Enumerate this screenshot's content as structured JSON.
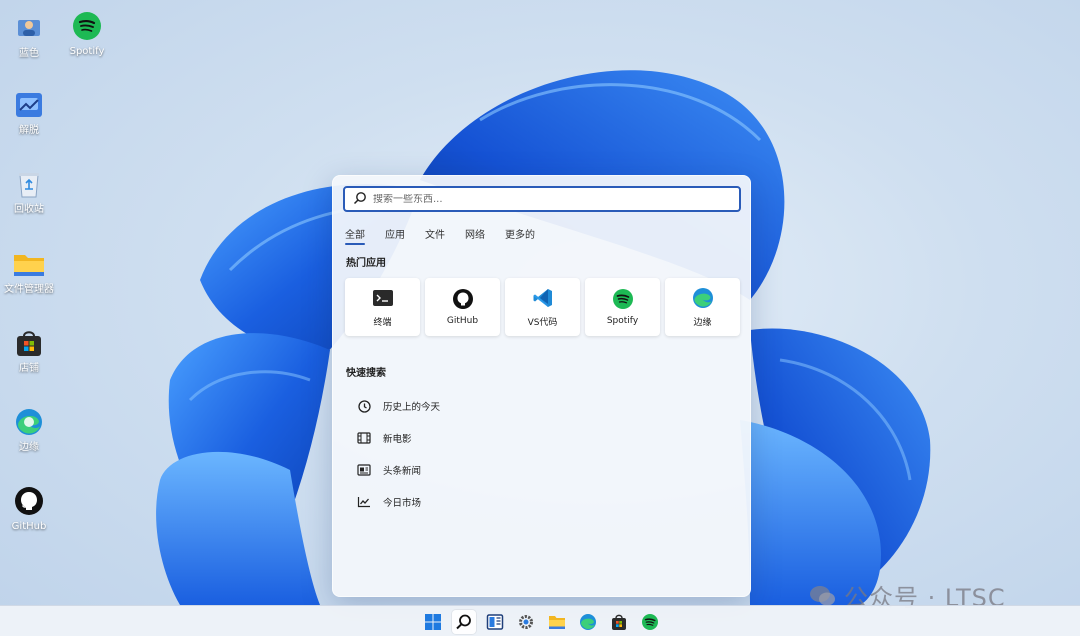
{
  "desktop": {
    "icons": [
      {
        "label": "蓝色",
        "icon": "user-folder-icon"
      },
      {
        "label": "Spotify",
        "icon": "spotify-icon"
      },
      {
        "label": "解脱",
        "icon": "control-panel-icon"
      },
      {
        "label": "回收站",
        "icon": "recycle-bin-icon"
      },
      {
        "label": "文件管理器",
        "icon": "folder-icon"
      },
      {
        "label": "店铺",
        "icon": "store-icon"
      },
      {
        "label": "边缘",
        "icon": "edge-icon"
      },
      {
        "label": "GitHub",
        "icon": "github-icon"
      }
    ]
  },
  "search": {
    "placeholder": "搜索一些东西...",
    "tabs": [
      {
        "label": "全部",
        "active": true
      },
      {
        "label": "应用",
        "active": false
      },
      {
        "label": "文件",
        "active": false
      },
      {
        "label": "网络",
        "active": false
      },
      {
        "label": "更多的",
        "active": false
      }
    ],
    "popular_title": "热门应用",
    "apps": [
      {
        "label": "终端",
        "icon": "terminal-icon"
      },
      {
        "label": "GitHub",
        "icon": "github-icon"
      },
      {
        "label": "VS代码",
        "icon": "vscode-icon"
      },
      {
        "label": "Spotify",
        "icon": "spotify-icon"
      },
      {
        "label": "边缘",
        "icon": "edge-icon"
      }
    ],
    "quick_title": "快速搜索",
    "quick": [
      {
        "label": "历史上的今天",
        "icon": "clock-icon"
      },
      {
        "label": "新电影",
        "icon": "film-icon"
      },
      {
        "label": "头条新闻",
        "icon": "news-icon"
      },
      {
        "label": "今日市场",
        "icon": "chart-icon"
      }
    ]
  },
  "taskbar": {
    "items": [
      {
        "icon": "windows-start-icon"
      },
      {
        "icon": "search-icon",
        "active": true
      },
      {
        "icon": "widgets-icon"
      },
      {
        "icon": "settings-icon"
      },
      {
        "icon": "file-explorer-icon"
      },
      {
        "icon": "edge-icon"
      },
      {
        "icon": "store-icon"
      },
      {
        "icon": "spotify-icon"
      }
    ]
  },
  "watermark": {
    "text": "公众号 · LTSC"
  },
  "colors": {
    "accent": "#2a5bb8",
    "spotify": "#1db954",
    "bloom": "#1a5fe0"
  }
}
